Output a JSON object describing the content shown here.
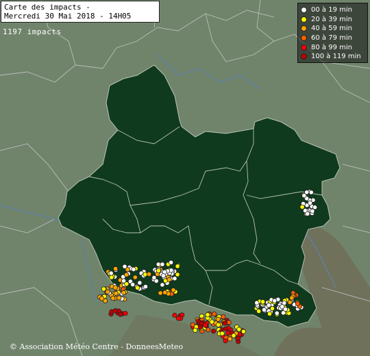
{
  "title": {
    "line1": "Carte des impacts -",
    "line2": "Mercredi 30 Mai 2018 - 14H05"
  },
  "impact_count": "1197 impacts",
  "legend": [
    {
      "label": "00 à 19 min",
      "color": "#ffffff"
    },
    {
      "label": "20 à 39 min",
      "color": "#ffff00"
    },
    {
      "label": "40 à 59 min",
      "color": "#ffa500"
    },
    {
      "label": "60 à 79 min",
      "color": "#ff6000"
    },
    {
      "label": "80 à 99 min",
      "color": "#ff0000"
    },
    {
      "label": "100 à 119 min",
      "color": "#c00000"
    }
  ],
  "credit": "© Association Météo Centre - DonneesMeteo",
  "colors": {
    "background": "#6c8169",
    "region_fill": "#0f3a1e",
    "border": "#c8c8c8",
    "river": "#5f7fa3"
  }
}
